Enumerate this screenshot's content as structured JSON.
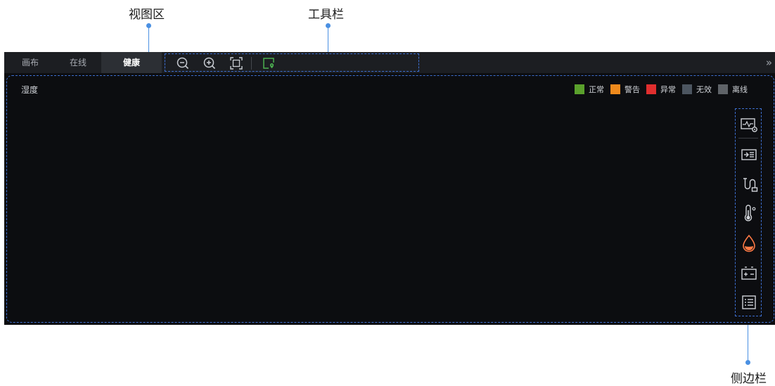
{
  "callouts": {
    "view_area": "视图区",
    "toolbar": "工具栏",
    "sidebar": "侧边栏"
  },
  "tabs": [
    {
      "label": "画布",
      "active": false
    },
    {
      "label": "在线",
      "active": false
    },
    {
      "label": "健康",
      "active": true
    }
  ],
  "toolbar": {
    "tools": [
      "zoom-out-icon",
      "zoom-in-icon",
      "fit-screen-icon",
      "location-marker-icon"
    ],
    "expand_label": "»"
  },
  "view": {
    "title": "湿度"
  },
  "legend": [
    {
      "label": "正常",
      "color": "#5aa02c"
    },
    {
      "label": "警告",
      "color": "#f08a1c"
    },
    {
      "label": "异常",
      "color": "#e02e2e"
    },
    {
      "label": "无效",
      "color": "#4c5560"
    },
    {
      "label": "离线",
      "color": "#5f6368"
    }
  ],
  "sidebar": {
    "buttons": [
      "monitor-settings-icon",
      "device-list-icon",
      "cable-icon",
      "temperature-icon",
      "humidity-icon",
      "battery-icon",
      "list-icon"
    ],
    "active": "humidity-icon",
    "accent": "#ff7a45"
  }
}
